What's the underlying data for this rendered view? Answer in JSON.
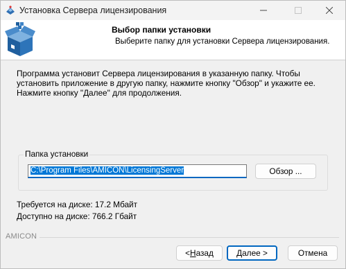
{
  "window": {
    "title": "Установка Сервера лицензирования"
  },
  "header": {
    "title": "Выбор папки установки",
    "subtitle": "Выберите папку для установки Сервера лицензирования."
  },
  "description": "Программа установит Сервера лицензирования в указанную папку. Чтобы установить приложение в другую папку, нажмите кнопку \"Обзор\" и укажите ее. Нажмите кнопку \"Далее\" для продолжения.",
  "install_folder": {
    "label": "Папка установки",
    "path": "C:\\Program Files\\AMICON\\LicensingServer",
    "browse_prefix": "Обзор ..."
  },
  "disk": {
    "required": "Требуется на диске: 17.2 Мбайт",
    "available": "Доступно на диске: 766.2 Гбайт"
  },
  "brand": "AMICON",
  "buttons": {
    "back_prefix": "< ",
    "back_underlined": "Н",
    "back_rest": "азад",
    "next_underlined": "Д",
    "next_rest": "алее >",
    "cancel": "Отмена"
  },
  "colors": {
    "accent": "#0067c0",
    "selection": "#0078d7"
  }
}
